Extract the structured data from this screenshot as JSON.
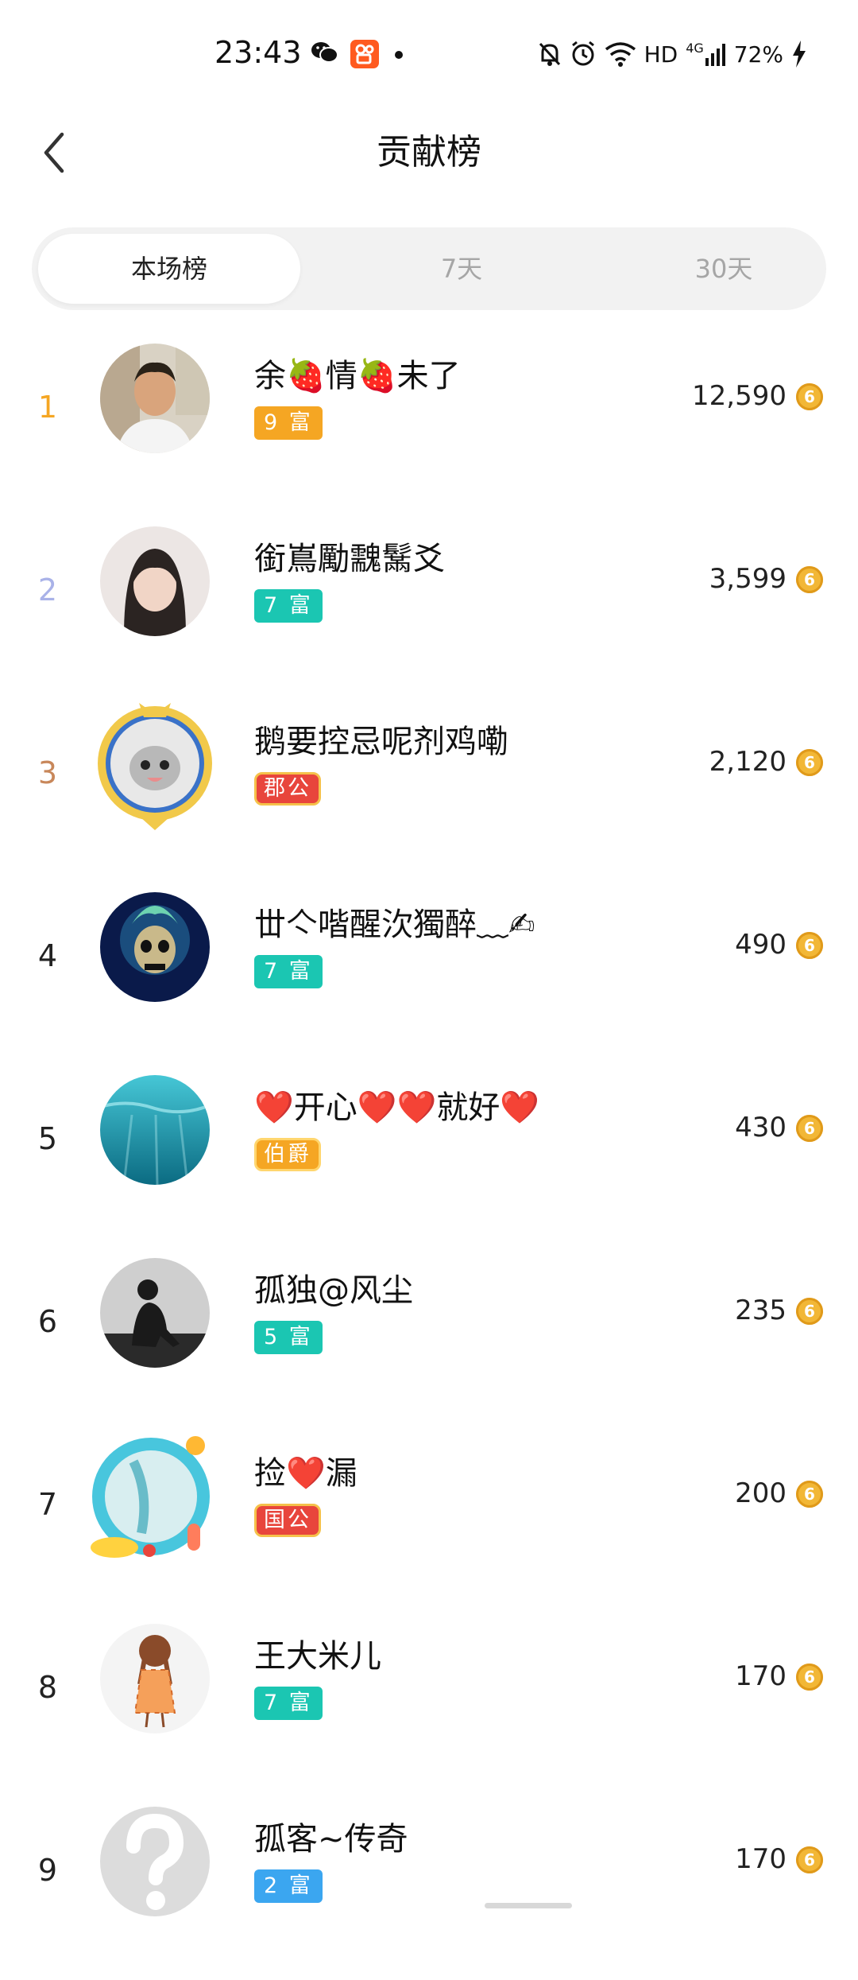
{
  "status_bar": {
    "time": "23:43",
    "network": "HD",
    "signal_label": "4G",
    "battery": "72%"
  },
  "header": {
    "title": "贡献榜"
  },
  "tabs": [
    {
      "label": "本场榜",
      "active": true
    },
    {
      "label": "7天",
      "active": false
    },
    {
      "label": "30天",
      "active": false
    }
  ],
  "leaderboard": [
    {
      "rank": "1",
      "rank_color": "#f5a623",
      "name": "余🍓情🍓未了",
      "badge": "9 富",
      "badge_style": "gold",
      "score": "12,590",
      "avatar_icon": "avatar-photo-man"
    },
    {
      "rank": "2",
      "rank_color": "#a9b2e8",
      "name": "銜嶌勵䰰鬗爻",
      "badge": "7 富",
      "badge_style": "teal",
      "score": "3,599",
      "avatar_icon": "avatar-photo-woman"
    },
    {
      "rank": "3",
      "rank_color": "#c8875a",
      "name": "鹅要控忌呢剂鸡嘞",
      "badge": "郡公",
      "badge_style": "red",
      "score": "2,120",
      "avatar_icon": "avatar-cat-frame"
    },
    {
      "rank": "4",
      "rank_color": "#222222",
      "name": "丗亽喈醒㳄獨醉﹏✍",
      "badge": "7 富",
      "badge_style": "teal",
      "score": "490",
      "avatar_icon": "avatar-skull"
    },
    {
      "rank": "5",
      "rank_color": "#222222",
      "name": "❤️开心❤️❤️就好❤️",
      "badge": "伯爵",
      "badge_style": "orange",
      "score": "430",
      "avatar_icon": "avatar-ocean"
    },
    {
      "rank": "6",
      "rank_color": "#222222",
      "name": "孤独@风尘",
      "badge": "5 富",
      "badge_style": "teal",
      "score": "235",
      "avatar_icon": "avatar-silhouette"
    },
    {
      "rank": "7",
      "rank_color": "#222222",
      "name": "捡❤️漏",
      "badge": "国公",
      "badge_style": "red",
      "score": "200",
      "avatar_icon": "avatar-summer-frame"
    },
    {
      "rank": "8",
      "rank_color": "#222222",
      "name": "王大米儿",
      "badge": "7 富",
      "badge_style": "teal",
      "score": "170",
      "avatar_icon": "avatar-cartoon-girl"
    },
    {
      "rank": "9",
      "rank_color": "#222222",
      "name": "孤客~传奇",
      "badge": "2 富",
      "badge_style": "blue",
      "score": "170",
      "avatar_icon": "avatar-question-mark"
    }
  ]
}
